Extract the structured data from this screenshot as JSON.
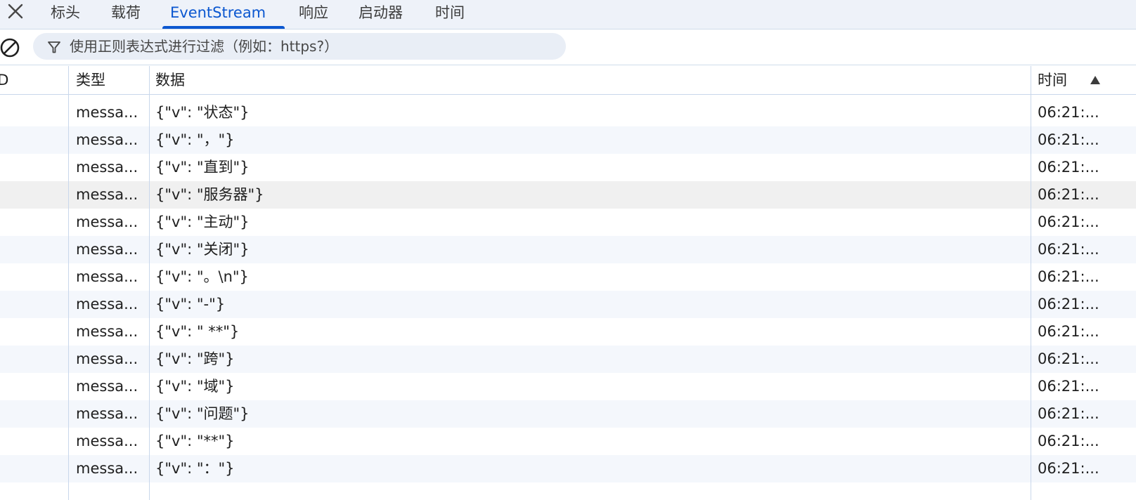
{
  "tabs": [
    {
      "label": "标头",
      "active": false
    },
    {
      "label": "载荷",
      "active": false
    },
    {
      "label": "EventStream",
      "active": true
    },
    {
      "label": "响应",
      "active": false
    },
    {
      "label": "启动器",
      "active": false
    },
    {
      "label": "时间",
      "active": false
    }
  ],
  "filter": {
    "placeholder": "使用正则表达式进行过滤（例如：https?）",
    "value": ""
  },
  "columns": {
    "id": "ID",
    "type": "类型",
    "data": "数据",
    "time": "时间",
    "sort": "ascending"
  },
  "rows": [
    {
      "type": "messa...",
      "data": "{\"v\": \"状态\"}",
      "time": "06:21:..."
    },
    {
      "type": "messa...",
      "data": "{\"v\": \"，\"}",
      "time": "06:21:..."
    },
    {
      "type": "messa...",
      "data": "{\"v\": \"直到\"}",
      "time": "06:21:..."
    },
    {
      "type": "messa...",
      "data": "{\"v\": \"服务器\"}",
      "time": "06:21:..."
    },
    {
      "type": "messa...",
      "data": "{\"v\": \"主动\"}",
      "time": "06:21:..."
    },
    {
      "type": "messa...",
      "data": "{\"v\": \"关闭\"}",
      "time": "06:21:..."
    },
    {
      "type": "messa...",
      "data": "{\"v\": \"。\\n\"}",
      "time": "06:21:..."
    },
    {
      "type": "messa...",
      "data": "{\"v\": \"-\"}",
      "time": "06:21:..."
    },
    {
      "type": "messa...",
      "data": "{\"v\": \" **\"}",
      "time": "06:21:..."
    },
    {
      "type": "messa...",
      "data": "{\"v\": \"跨\"}",
      "time": "06:21:..."
    },
    {
      "type": "messa...",
      "data": "{\"v\": \"域\"}",
      "time": "06:21:..."
    },
    {
      "type": "messa...",
      "data": "{\"v\": \"问题\"}",
      "time": "06:21:..."
    },
    {
      "type": "messa...",
      "data": "{\"v\": \"**\"}",
      "time": "06:21:..."
    },
    {
      "type": "messa...",
      "data": "{\"v\": \"：\"}",
      "time": "06:21:..."
    }
  ],
  "colors": {
    "accent": "#0b57d0",
    "tabbar_bg": "#eef2f9",
    "row_alt_bg": "#f4f7fc",
    "row_hover_bg": "#f0f0f0",
    "divider": "#c9d7eb"
  },
  "icons": {
    "close": "close-icon",
    "clear": "clear-log-icon",
    "filter": "filter-funnel-icon",
    "sort": "sort-ascending-icon"
  }
}
